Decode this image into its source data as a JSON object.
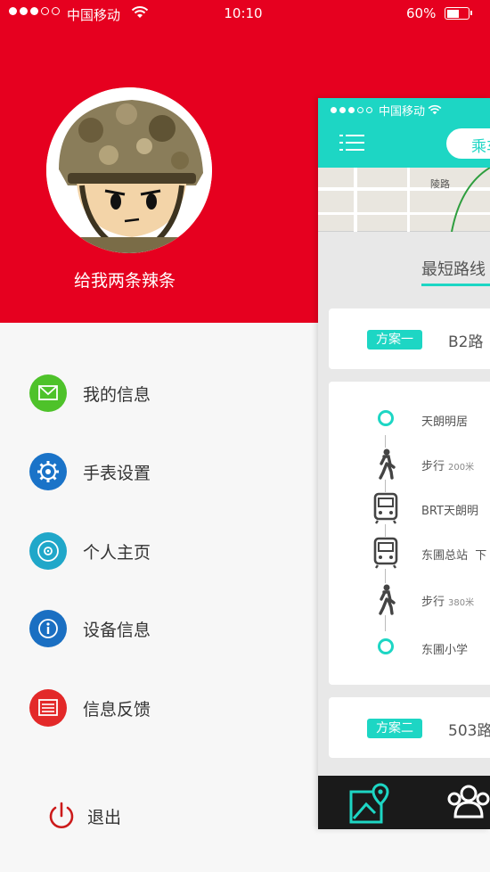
{
  "status_bar": {
    "carrier": "中国移动",
    "time": "10:10",
    "battery": "60%"
  },
  "drawer": {
    "username": "给我两条辣条",
    "menu": [
      {
        "label": "我的信息",
        "icon": "mail-icon",
        "color": "#4ec22a"
      },
      {
        "label": "手表设置",
        "icon": "gear-icon",
        "color": "#1a73c8"
      },
      {
        "label": "个人主页",
        "icon": "disc-icon",
        "color": "#20a7c9"
      },
      {
        "label": "设备信息",
        "icon": "info-icon",
        "color": "#1a6fc2"
      },
      {
        "label": "信息反馈",
        "icon": "feedback-icon",
        "color": "#e32929"
      }
    ],
    "logout_label": "退出"
  },
  "main": {
    "status_carrier": "中国移动",
    "header_tab": "乘车",
    "map_label": "陵路",
    "route_tab": "最短路线",
    "plans": [
      {
        "badge": "方案一",
        "route": "B2路"
      },
      {
        "badge": "方案二",
        "route": "503路"
      }
    ],
    "steps": [
      {
        "type": "start",
        "icon": "start-point-icon",
        "name": "天朗明居",
        "extra": ""
      },
      {
        "type": "walk",
        "icon": "walk-icon",
        "name": "步行",
        "extra": "200米"
      },
      {
        "type": "bus",
        "icon": "bus-icon",
        "name": "BRT天朗明",
        "extra": ""
      },
      {
        "type": "bus",
        "icon": "bus-icon",
        "name": "东圃总站",
        "extra": "下"
      },
      {
        "type": "walk",
        "icon": "walk-icon",
        "name": "步行",
        "extra": "380米"
      },
      {
        "type": "end",
        "icon": "end-point-icon",
        "name": "东圃小学",
        "extra": ""
      }
    ]
  },
  "colors": {
    "drawer_red": "#e6001f",
    "accent_teal": "#1dd6c4"
  }
}
